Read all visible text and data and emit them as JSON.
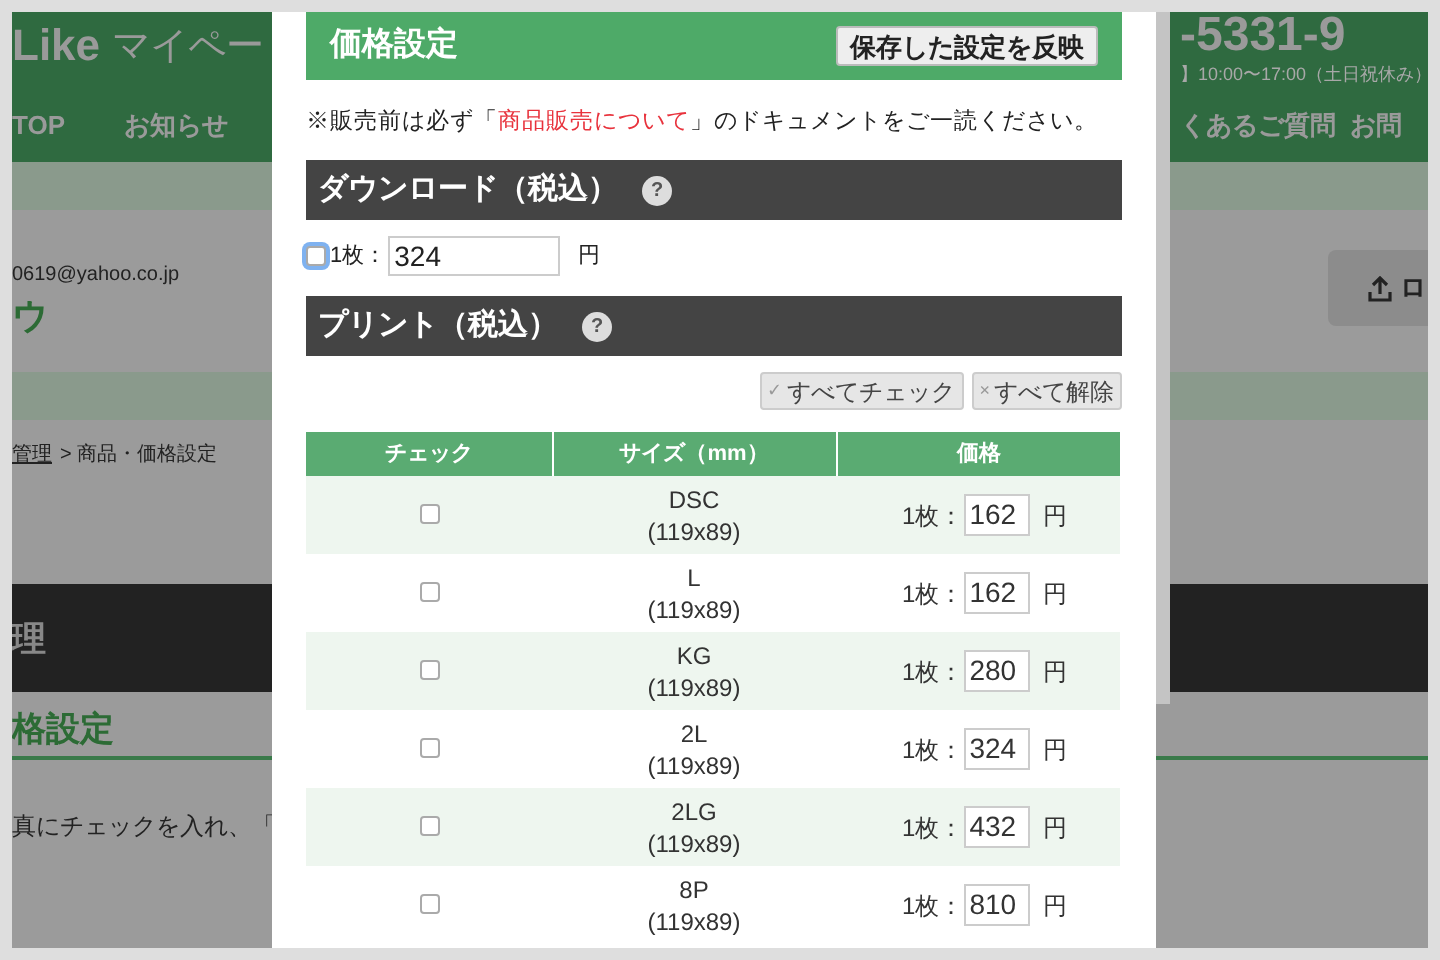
{
  "background_page": {
    "header": {
      "brand": "Like",
      "subtitle": "マイペー",
      "phone": "-5331-9",
      "hours": "】10:00〜17:00（土日祝休み）",
      "nav": [
        "TOP",
        "お知らせ",
        "くあるご質問",
        "お問"
      ]
    },
    "account": {
      "email": "0619@yahoo.co.jp",
      "name": "ウ",
      "button_label": "ロ"
    },
    "breadcrumb": {
      "link": "管理",
      "current": "> 商品・価格設定"
    },
    "section_title": "理",
    "subsection_title": "格設定",
    "instruction": "真にチェックを入れ、「"
  },
  "modal": {
    "title": "価格設定",
    "apply_button": "保存した設定を反映",
    "notice": {
      "before": "※販売前は必ず「",
      "link": "商品販売について",
      "after": "」のドキュメントをご一読ください。"
    },
    "download": {
      "heading": "ダウンロード（税込）",
      "help": "?",
      "checked": false,
      "count_label": "1枚：",
      "value": "324",
      "unit": "円"
    },
    "print": {
      "heading": "プリント（税込）",
      "help": "?",
      "actions": [
        {
          "icon": "✓",
          "label": "すべてチェック"
        },
        {
          "icon": "×",
          "label": "すべて解除"
        }
      ],
      "columns": [
        "チェック",
        "サイズ（mm）",
        "価格"
      ],
      "rows": [
        {
          "size": "DSC",
          "dimensions": "(119x89)",
          "checked": false,
          "count_label": "1枚：",
          "value": "162",
          "unit": "円"
        },
        {
          "size": "L",
          "dimensions": "(119x89)",
          "checked": false,
          "count_label": "1枚：",
          "value": "162",
          "unit": "円"
        },
        {
          "size": "KG",
          "dimensions": "(119x89)",
          "checked": false,
          "count_label": "1枚：",
          "value": "280",
          "unit": "円"
        },
        {
          "size": "2L",
          "dimensions": "(119x89)",
          "checked": false,
          "count_label": "1枚：",
          "value": "324",
          "unit": "円"
        },
        {
          "size": "2LG",
          "dimensions": "(119x89)",
          "checked": false,
          "count_label": "1枚：",
          "value": "432",
          "unit": "円"
        },
        {
          "size": "8P",
          "dimensions": "(119x89)",
          "checked": false,
          "count_label": "1枚：",
          "value": "810",
          "unit": "円"
        }
      ]
    }
  }
}
